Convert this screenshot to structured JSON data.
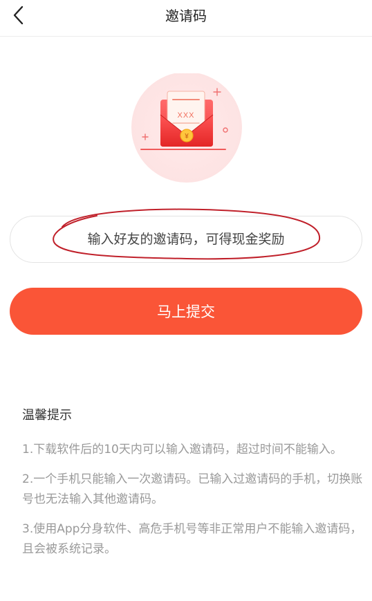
{
  "header": {
    "title": "邀请码",
    "back_icon": "chevron-left-icon"
  },
  "hero": {
    "illustration_icon": "red-envelope-icon",
    "card_text": "XXX",
    "coin_symbol": "¥"
  },
  "invite_input": {
    "placeholder": "输入好友的邀请码，可得现金奖励",
    "value": ""
  },
  "submit_button": {
    "label": "马上提交"
  },
  "tips": {
    "heading": "温馨提示",
    "items": [
      "1.下载软件后的10天内可以输入邀请码，超过时间不能输入。",
      "2.一个手机只能输入一次邀请码。已输入过邀请码的手机，切换账号也无法输入其他邀请码。",
      "3.使用App分身软件、高危手机号等非正常用户不能输入邀请码，且会被系统记录。"
    ]
  },
  "colors": {
    "accent": "#fa5537",
    "annotation": "#c0202a",
    "tip_text": "#999999"
  }
}
